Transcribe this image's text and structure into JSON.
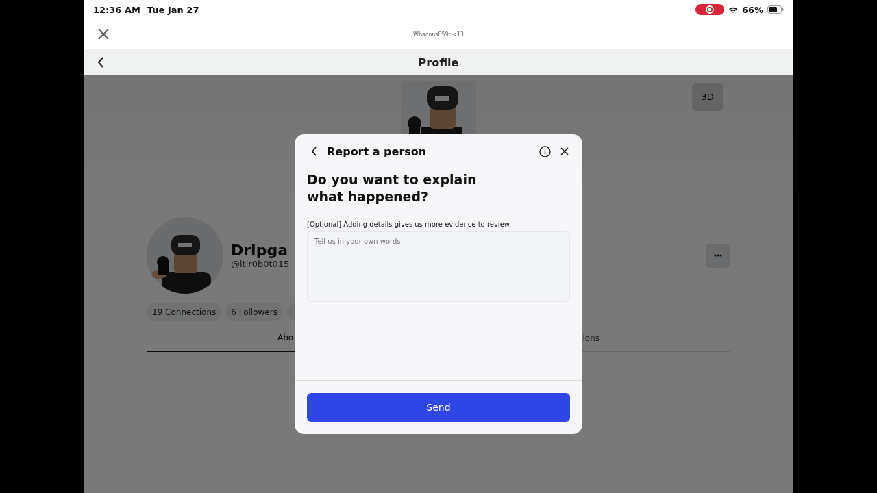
{
  "status_bar": {
    "time": "12:36 AM",
    "date": "Tue Jan 27",
    "battery": "66%"
  },
  "top_bar": {
    "title": "Wbacons859: <13"
  },
  "nav": {
    "title": "Profile"
  },
  "profile": {
    "view_button": "3D",
    "display_name": "Dripga",
    "username": "@ltlr0b0t015",
    "stats": [
      {
        "label": "19 Connections"
      },
      {
        "label": "6 Followers"
      }
    ],
    "tabs": [
      {
        "label": "Abo",
        "selected": true
      },
      {
        "label": "ions",
        "selected": false
      }
    ]
  },
  "dialog": {
    "title": "Report a person",
    "heading": "Do you want to explain what happened?",
    "hint": "[Optional] Adding details gives us more evidence to review.",
    "placeholder": "Tell us in your own words",
    "send": "Send"
  }
}
